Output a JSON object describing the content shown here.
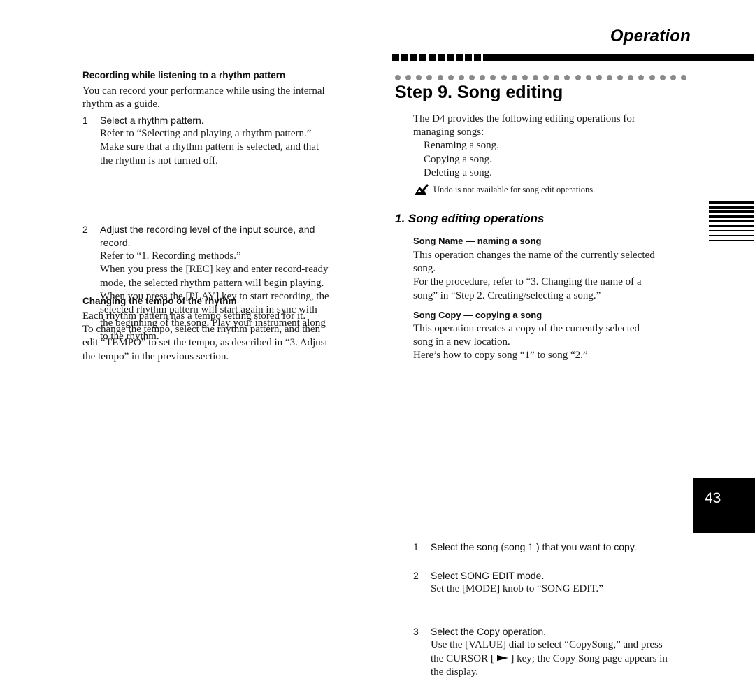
{
  "header": {
    "section_title": "Operation",
    "band_square_count": 10,
    "dot_count": 28
  },
  "left": {
    "section1": {
      "heading": "Recording while listening to a rhythm pattern",
      "intro": [
        "You can record your performance while using the internal",
        "rhythm as a guide."
      ],
      "steps": [
        {
          "num": "1",
          "label": "Select a rhythm pattern.",
          "body": [
            "Refer to “Selecting and playing a rhythm pattern.”",
            "Make sure that a rhythm pattern is selected, and that",
            "the rhythm is not turned off."
          ]
        },
        {
          "num": "2",
          "label_lines": [
            "Adjust the recording level of the input source, and",
            "record."
          ],
          "body": [
            "Refer to “1. Recording methods.”",
            "When you press the [REC] key and enter record-ready",
            "mode, the selected rhythm pattern will begin playing.",
            "When you press the [PLAY] key to start recording, the",
            "selected rhythm pattern will start again in sync with",
            "the beginning of the song. Play your instrument along",
            "to the rhythm."
          ]
        }
      ]
    },
    "section2": {
      "heading": "Changing the tempo of the rhythm",
      "body": [
        "Each rhythm pattern has a tempo setting stored for it.",
        "To change the tempo, select the rhythm pattern, and then",
        "edit “TEMPO” to set the tempo, as described in “3. Adjust",
        "the tempo” in the previous section."
      ]
    }
  },
  "right": {
    "step_title": "Step 9. Song editing",
    "intro": [
      "The D4 provides the following editing operations for",
      "managing songs:"
    ],
    "operations": [
      "Renaming a song.",
      "Copying a song.",
      "Deleting a song."
    ],
    "note_icon": "note-icon",
    "note": "Undo is not available for song edit operations.",
    "section_title": "1. Song editing operations",
    "song_name": {
      "heading": "Song Name — naming a song",
      "body": [
        "This operation changes the name of the currently selected",
        "song.",
        "For the procedure, refer to “3. Changing the name of a",
        "song” in “Step 2. Creating/selecting a song.”"
      ]
    },
    "song_copy": {
      "heading": "Song Copy — copying a song",
      "body": [
        "This operation creates a copy of the currently selected",
        "song in a new location.",
        "Here’s how to copy song “1” to song “2.”"
      ],
      "steps": [
        {
          "num": "1",
          "label": "Select the song (song  1 ) that you want to copy.",
          "body": []
        },
        {
          "num": "2",
          "label": "Select  SONG EDIT  mode.",
          "body": [
            "Set the [MODE] knob to “SONG EDIT.”"
          ]
        },
        {
          "num": "3",
          "label": "Select the Copy operation.",
          "body": [
            "Use the [VALUE] dial to select “CopySong,” and press"
          ],
          "body2_pre": "the CURSOR [ ",
          "body2_icon": "right-arrow-icon",
          "body2_post": " ] key; the Copy Song page appears in",
          "body3": "the display."
        }
      ]
    }
  },
  "thumb_index": {
    "line_count": 10
  },
  "page_number": "43"
}
